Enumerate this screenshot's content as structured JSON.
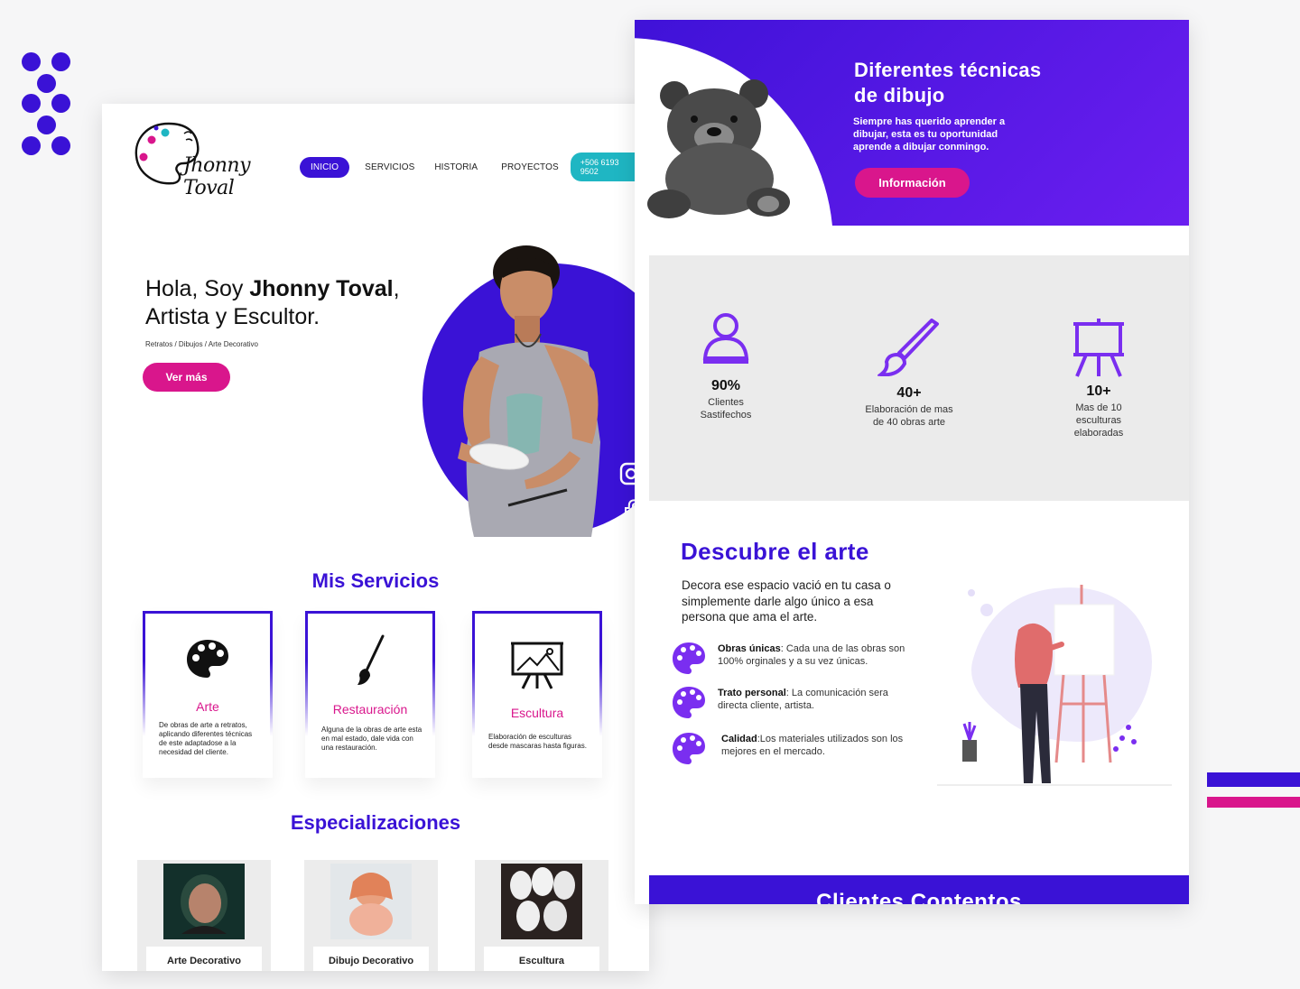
{
  "brand": {
    "logo_text": "Jhonny Toval"
  },
  "nav": {
    "items": [
      "INICIO",
      "SERVICIOS",
      "HISTORIA",
      "PROYECTOS"
    ],
    "phone": "+506 6193 9502"
  },
  "hero": {
    "greeting": "Hola, Soy ",
    "name": "Jhonny Toval",
    "comma": ",",
    "subtitle": "Artista y Escultor.",
    "tags": "Retratos / Dibujos / Arte Decorativo",
    "cta": "Ver más"
  },
  "services": {
    "title": "Mis Servicios",
    "items": [
      {
        "name": "Arte",
        "icon": "palette-icon",
        "desc": "De obras de arte a retratos, aplicando diferentes técnicas de este adaptadose a la necesidad del cliente."
      },
      {
        "name": "Restauración",
        "icon": "brush-icon",
        "desc": "Alguna de la obras de arte esta en mal estado, dale vida con una restauración."
      },
      {
        "name": "Escultura",
        "icon": "easel-icon",
        "desc": "Elaboración de esculturas desde mascaras hasta figuras."
      }
    ]
  },
  "specializations": {
    "title": "Especializaciones",
    "items": [
      "Arte Decorativo",
      "Dibujo Decorativo",
      "Escultura"
    ]
  },
  "banner": {
    "title_line1": "Diferentes técnicas",
    "title_line2": "de dibujo",
    "text": "Siempre has querido aprender a dibujar, esta es tu oportunidad aprende a dibujar conmingo.",
    "cta": "Información"
  },
  "stats": [
    {
      "value": "90%",
      "label_line1": "Clientes",
      "label_line2": "Sastifechos",
      "label_line3": "",
      "icon": "user-icon"
    },
    {
      "value": "40+",
      "label_line1": "Elaboración de mas",
      "label_line2": "de 40 obras arte",
      "label_line3": "",
      "icon": "brush-icon"
    },
    {
      "value": "10+",
      "label_line1": "Mas de 10",
      "label_line2": "esculturas",
      "label_line3": "elaboradas",
      "icon": "easel-icon"
    }
  ],
  "discover": {
    "title": "Descubre el arte",
    "text": "Decora ese espacio vació en tu casa o simplemente darle algo único a esa persona que ama el arte.",
    "features": [
      {
        "bold": "Obras únicas",
        "text": ": Cada una de las obras son 100% orginales y a su vez únicas."
      },
      {
        "bold": "Trato personal",
        "text": ": La comunicación sera directa cliente, artista."
      },
      {
        "bold": "Calidad",
        "text": ":Los materiales utilizados son los mejores en el mercado."
      }
    ]
  },
  "clients": {
    "title": "Clientes Contentos"
  },
  "colors": {
    "primary": "#3a12d6",
    "accent": "#d9168c",
    "teal": "#1fb6c3"
  }
}
